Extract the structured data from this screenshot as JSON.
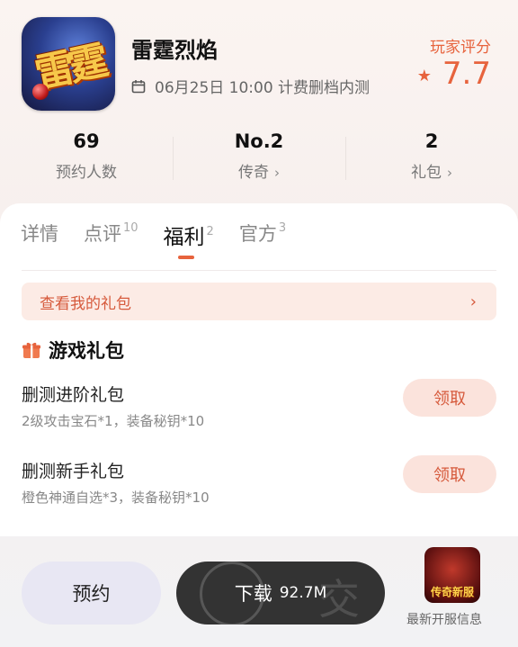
{
  "game": {
    "title": "雷霆烈焰",
    "icon_text": "雷霆",
    "release_text": "06月25日 10:00 计费删档内测",
    "rating_label": "玩家评分",
    "rating_value": "7.7"
  },
  "stats": [
    {
      "value": "69",
      "label": "预约人数"
    },
    {
      "value": "No.2",
      "label": "传奇",
      "chevron": "›"
    },
    {
      "value": "2",
      "label": "礼包",
      "chevron": "›"
    }
  ],
  "tabs": [
    {
      "label": "详情",
      "count": ""
    },
    {
      "label": "点评",
      "count": "10"
    },
    {
      "label": "福利",
      "count": "2",
      "active": true
    },
    {
      "label": "官方",
      "count": "3"
    }
  ],
  "my_gift": {
    "label": "查看我的礼包",
    "arrow": "›"
  },
  "gift_section": {
    "title": "游戏礼包"
  },
  "gifts": [
    {
      "name": "删测进阶礼包",
      "desc": "2级攻击宝石*1，装备秘钥*10",
      "button": "领取"
    },
    {
      "name": "删测新手礼包",
      "desc": "橙色神通自选*3，装备秘钥*10",
      "button": "领取"
    }
  ],
  "bottom": {
    "reserve_label": "预约",
    "download_label": "下载",
    "download_size": "92.7M",
    "watermark_char": "交",
    "server_thumb_text": "传奇新服",
    "server_label": "最新开服信息"
  },
  "colors": {
    "accent": "#e7633d",
    "download_bg": "#333333",
    "reserve_bg": "#e8e7f3",
    "claim_bg": "#fbe3dc"
  }
}
